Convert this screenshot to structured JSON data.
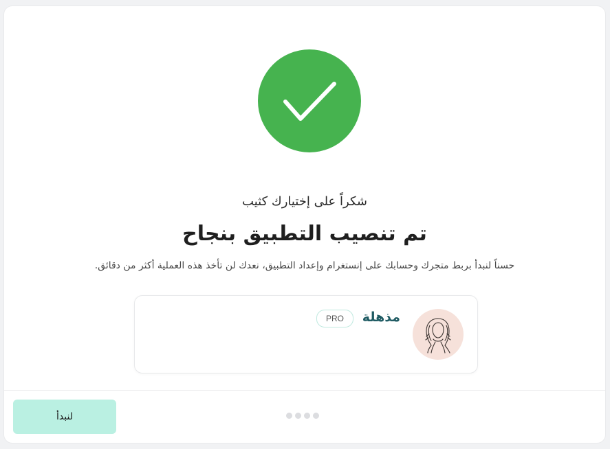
{
  "success": {
    "icon": "check-icon",
    "color": "#46b34f"
  },
  "thanks_text": "شكراً على إختيارك كثيب",
  "headline": "تم تنصيب التطبيق بنجاح",
  "subtext": "حسناً لنبدأ بربط متجرك وحسابك على إنستغرام وإعداد التطبيق، نعدك لن تأخذ هذه العملية أكثر من دقائق.",
  "theme_card": {
    "name": "مذهلة",
    "badge": "PRO",
    "avatar_icon": "woman-hijab-avatar"
  },
  "footer": {
    "start_button_label": "لنبدأ",
    "button_color": "#baf0e2",
    "step_dots": 4
  }
}
